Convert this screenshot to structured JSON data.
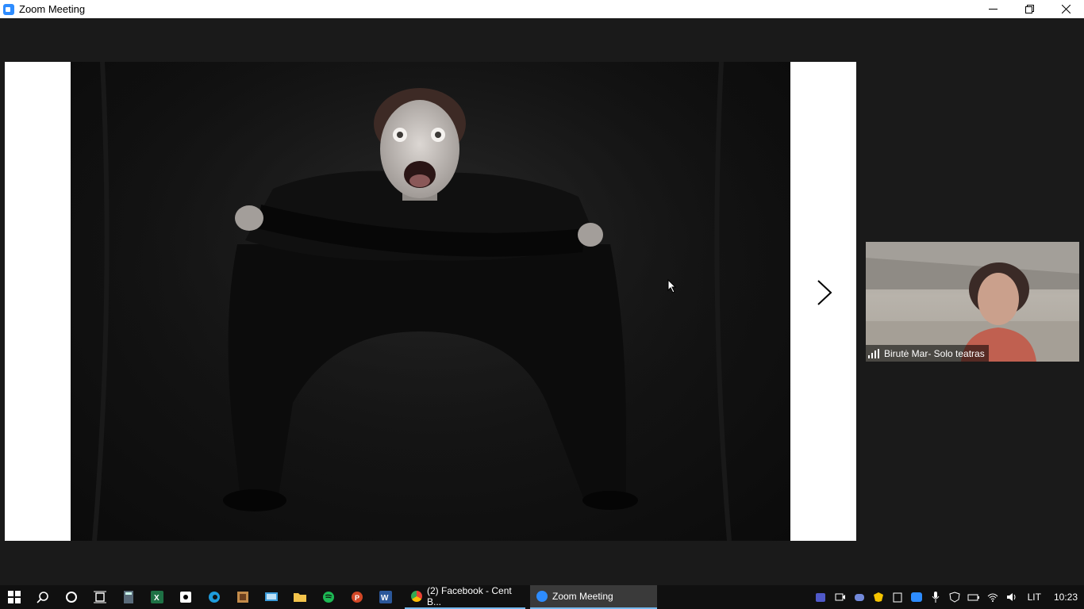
{
  "window": {
    "title": "Zoom Meeting"
  },
  "participant": {
    "name": "Birutė Mar- Solo teatras"
  },
  "taskbar": {
    "apps": [
      {
        "label": "(2) Facebook - Cent B...",
        "icon": "chrome-icon"
      },
      {
        "label": "Zoom Meeting",
        "icon": "zoom-icon"
      }
    ],
    "language": "LIT",
    "time": "10:23"
  },
  "colors": {
    "accent": "#2d8cff",
    "taskbar": "#101010",
    "meeting_bg": "#1a1a1a"
  }
}
